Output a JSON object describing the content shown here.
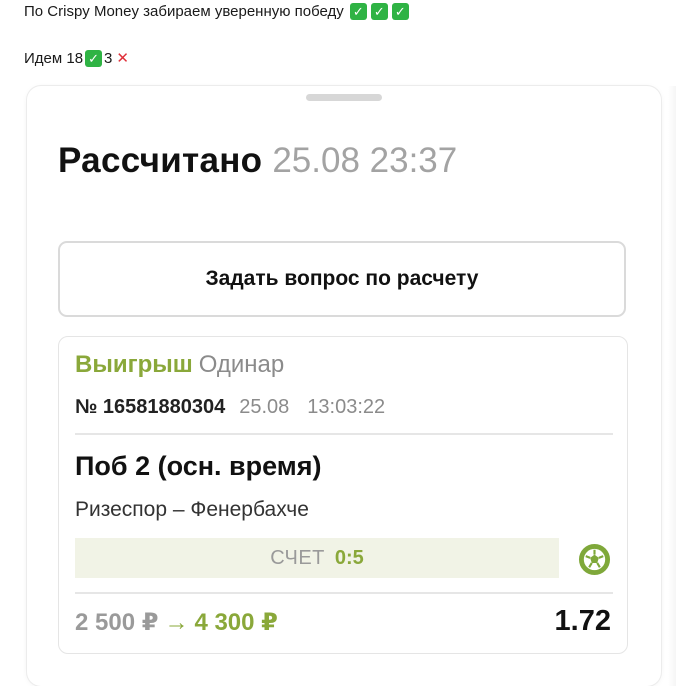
{
  "message": {
    "line1_text": "По Crispy Money забираем уверенную победу",
    "line2_prefix": "Идем 18",
    "line2_losses": "3"
  },
  "sheet": {
    "title": "Рассчитано",
    "date": "25.08 23:37",
    "ask_button_label": "Задать вопрос по расчету"
  },
  "bet": {
    "status": "Выигрыш",
    "type": "Одинар",
    "number": "№ 16581880304",
    "date": "25.08",
    "time": "13:03:22",
    "market": "Поб 2 (осн. время)",
    "match": "Ризеспор – Фенербахче",
    "score_label": "СЧЕТ",
    "score_value": "0:5",
    "stake": "2 500 ₽",
    "payout": "4 300 ₽",
    "odds": "1.72",
    "sport_icon": "soccer-ball-icon"
  },
  "colors": {
    "win_green": "#8aa83a",
    "check_green": "#2fb344",
    "cross_red": "#e0303a",
    "score_bg": "#f1f3e6"
  }
}
